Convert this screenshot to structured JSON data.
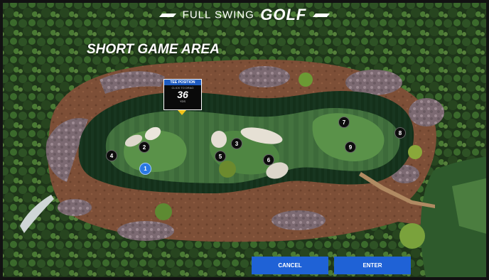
{
  "brand": {
    "prefix": "FULL SWING",
    "name": "GOLF"
  },
  "title": "SHORT GAME AREA",
  "tee_position": {
    "header": "TEE POSITION",
    "hint": "CLICK TO DRAG",
    "distance": "36",
    "unit": "YDS"
  },
  "targets": [
    {
      "label": "1",
      "active": true
    },
    {
      "label": "2"
    },
    {
      "label": "3"
    },
    {
      "label": "4"
    },
    {
      "label": "5"
    },
    {
      "label": "6"
    },
    {
      "label": "7"
    },
    {
      "label": "8"
    },
    {
      "label": "9"
    }
  ],
  "buttons": {
    "cancel": "CANCEL",
    "enter": "ENTER"
  },
  "colors": {
    "button": "#1f62d6",
    "tee_header": "#1e5bc0",
    "tee_pointer": "#f2c21a",
    "active_marker": "#2a78e2"
  }
}
